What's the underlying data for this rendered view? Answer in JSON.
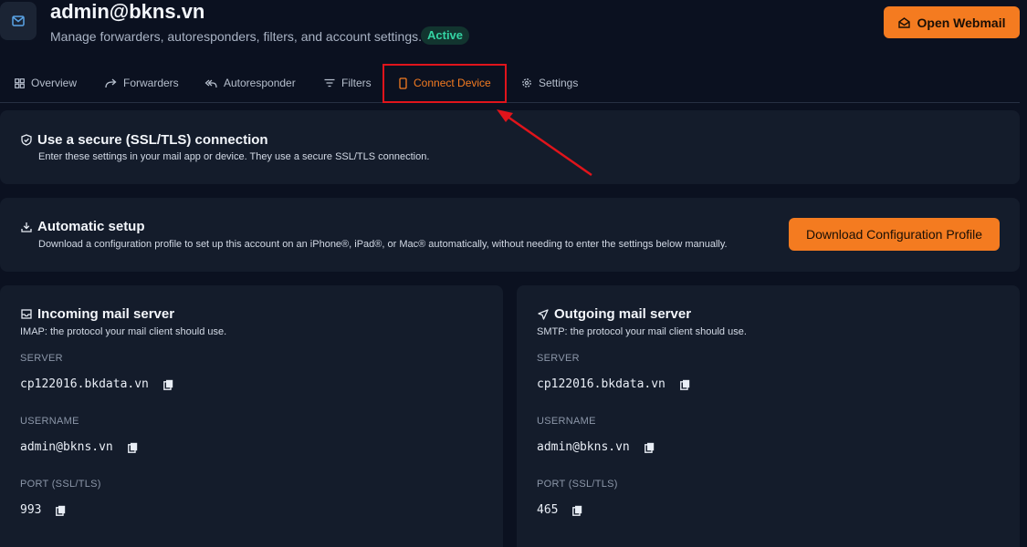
{
  "header": {
    "title": "admin@bkns.vn",
    "subtitle": "Manage forwarders, autoresponders, filters, and account settings.",
    "status": "Active",
    "open_webmail": "Open Webmail"
  },
  "tabs": [
    {
      "label": "Overview",
      "icon": "grid-icon"
    },
    {
      "label": "Forwarders",
      "icon": "forward-arrow-icon"
    },
    {
      "label": "Autoresponder",
      "icon": "reply-all-icon"
    },
    {
      "label": "Filters",
      "icon": "filter-icon"
    },
    {
      "label": "Connect Device",
      "icon": "phone-icon",
      "active": true
    },
    {
      "label": "Settings",
      "icon": "gear-icon"
    }
  ],
  "secure": {
    "title": "Use a secure (SSL/TLS) connection",
    "desc": "Enter these settings in your mail app or device. They use a secure SSL/TLS connection."
  },
  "auto_setup": {
    "title": "Automatic setup",
    "desc": "Download a configuration profile to set up this account on an iPhone®, iPad®, or Mac® automatically, without needing to enter the settings below manually.",
    "button": "Download Configuration Profile"
  },
  "incoming": {
    "title": "Incoming mail server",
    "desc": "IMAP: the protocol your mail client should use.",
    "server_label": "SERVER",
    "server": "cp122016.bkdata.vn",
    "username_label": "USERNAME",
    "username": "admin@bkns.vn",
    "port_label": "PORT (SSL/TLS)",
    "port": "993"
  },
  "outgoing": {
    "title": "Outgoing mail server",
    "desc": "SMTP: the protocol your mail client should use.",
    "server_label": "SERVER",
    "server": "cp122016.bkdata.vn",
    "username_label": "USERNAME",
    "username": "admin@bkns.vn",
    "port_label": "PORT (SSL/TLS)",
    "port": "465"
  },
  "colors": {
    "accent": "#f47b20",
    "background": "#0b1120",
    "card": "#141c2b",
    "badge_text": "#34d3a3",
    "annotation": "#e0141b"
  }
}
